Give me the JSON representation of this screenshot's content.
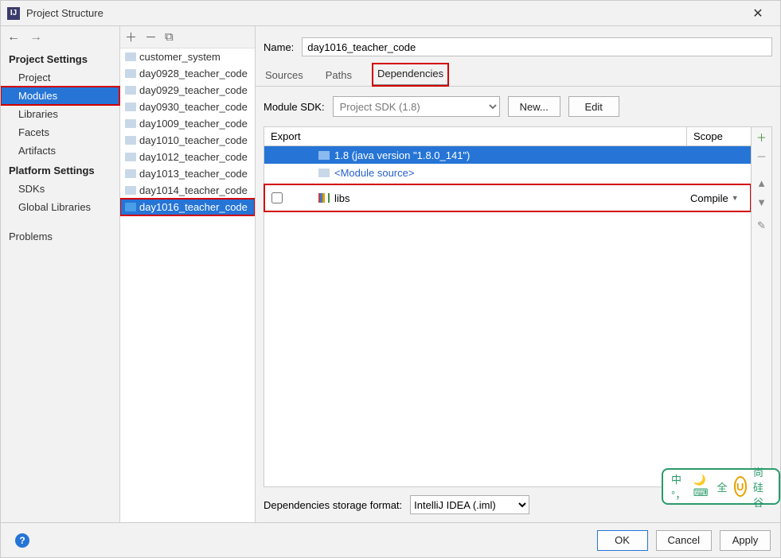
{
  "window": {
    "title": "Project Structure"
  },
  "nav": {
    "project_settings_title": "Project Settings",
    "platform_settings_title": "Platform Settings",
    "items": {
      "project": "Project",
      "modules": "Modules",
      "libraries": "Libraries",
      "facets": "Facets",
      "artifacts": "Artifacts",
      "sdks": "SDKs",
      "global_libraries": "Global Libraries",
      "problems": "Problems"
    }
  },
  "modules_list": [
    "customer_system",
    "day0928_teacher_code",
    "day0929_teacher_code",
    "day0930_teacher_code",
    "day1009_teacher_code",
    "day1010_teacher_code",
    "day1012_teacher_code",
    "day1013_teacher_code",
    "day1014_teacher_code",
    "day1016_teacher_code"
  ],
  "selected_module": "day1016_teacher_code",
  "name_label": "Name:",
  "name_value": "day1016_teacher_code",
  "tabs": {
    "sources": "Sources",
    "paths": "Paths",
    "dependencies": "Dependencies"
  },
  "sdk": {
    "label": "Module SDK:",
    "value": "Project SDK (1.8)",
    "new_btn": "New...",
    "edit_btn": "Edit"
  },
  "dep_table": {
    "export_header": "Export",
    "scope_header": "Scope",
    "rows": [
      {
        "label": "1.8 (java version \"1.8.0_141\")",
        "selected": true,
        "type": "sdk"
      },
      {
        "label": "<Module source>",
        "type": "module_src"
      },
      {
        "label": "libs",
        "scope": "Compile",
        "checkbox": false,
        "type": "lib"
      }
    ]
  },
  "storage": {
    "label": "Dependencies storage format:",
    "value": "IntelliJ IDEA (.iml)"
  },
  "watermark": {
    "a": "中 °，",
    "b": "全",
    "c": "尚硅谷"
  },
  "footer": {
    "ok": "OK",
    "cancel": "Cancel",
    "apply": "Apply"
  }
}
